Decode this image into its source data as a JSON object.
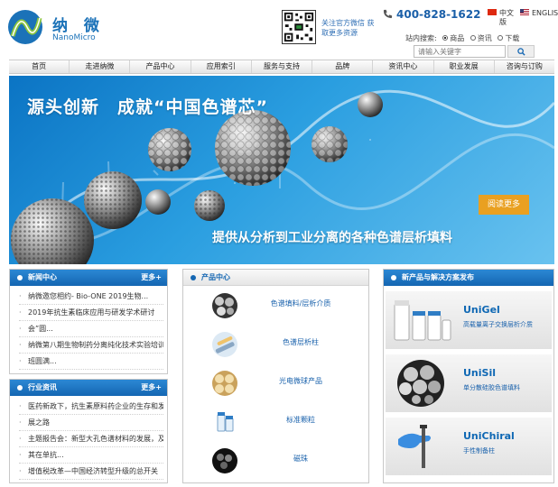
{
  "header": {
    "logo_cn": "纳 微",
    "logo_en": "NanoMicro",
    "qr_text": "关注官方微信 获取更多资源",
    "phone": "400-828-1622",
    "lang_cn": "中文版",
    "lang_en": "ENGLISH",
    "search_label": "站内搜索:",
    "search_options": [
      "商品",
      "资讯",
      "下载"
    ],
    "search_placeholder": "请输入关键字"
  },
  "nav": [
    "首页",
    "走进纳微",
    "产品中心",
    "应用索引",
    "服务与支持",
    "品牌",
    "资讯中心",
    "职业发展",
    "咨询与订购"
  ],
  "banner": {
    "title": "源头创新　成就“中国色谱芯”",
    "subtitle": "提供从分析到工业分离的各种色谱层析填料",
    "button": "阅读更多"
  },
  "news": {
    "title": "新闻中心",
    "more": "更多+",
    "items": [
      "纳微邀您相约- Bio-ONE 2019生物...",
      "2019年抗生素临床应用与研发学术研讨",
      "会”圆...",
      "纳微第八期生物制药分离纯化技术实验培训",
      "班圆满..."
    ]
  },
  "industry": {
    "title": "行业资讯",
    "more": "更多+",
    "items": [
      "医药新政下，抗生素原料药企业的生存和发",
      "展之路",
      "主题报告会：新型大孔色谱材料的发展，及",
      "其在单抗...",
      "增值税改革—中国经济转型升级的总开关"
    ]
  },
  "products": {
    "title": "产品中心",
    "items": [
      "色谱填料/层析介质",
      "色谱层析柱",
      "光电微球产品",
      "标准颗粒",
      "磁珠"
    ]
  },
  "new_products": {
    "title": "新产品与解决方案发布",
    "items": [
      {
        "name": "UniGel",
        "desc": "高载量离子交换层析介质"
      },
      {
        "name": "UniSil",
        "desc": "单分散硅胶色谱填料"
      },
      {
        "name": "UniChiral",
        "desc": "手性制备柱"
      }
    ]
  },
  "colors": {
    "brand_blue": "#1466b2",
    "accent_orange": "#e9a021"
  }
}
